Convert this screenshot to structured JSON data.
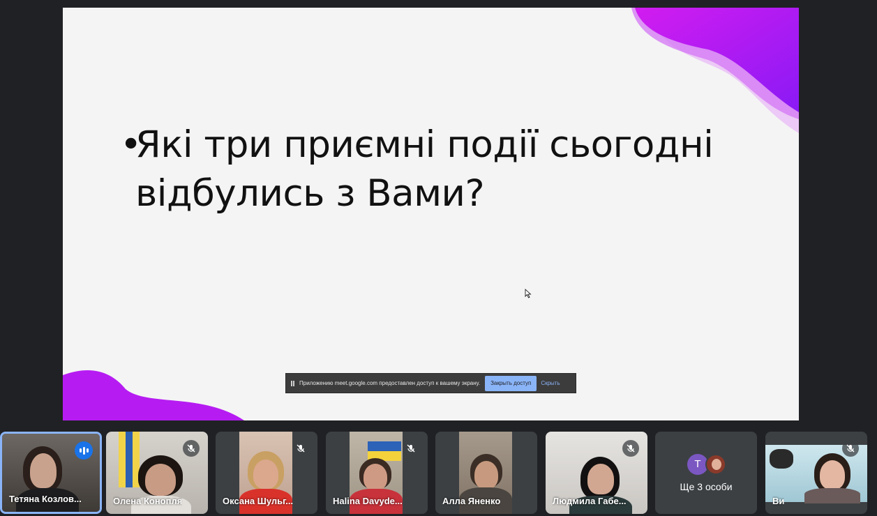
{
  "slide": {
    "bullet": "•",
    "line1": "Які три приємні події сьогодні",
    "line2": "відбулись з Вами?"
  },
  "share_bar": {
    "message": "Приложению meet.google.com предоставлен доступ к вашему экрану.",
    "stop_label": "Закрыть доступ",
    "hide_label": "Скрыть"
  },
  "participants": [
    {
      "name": "Тетяна Козлов...",
      "speaking": true
    },
    {
      "name": "Олена Конопля",
      "muted": true
    },
    {
      "name": "Оксана Шульг...",
      "muted": true
    },
    {
      "name": "Halina Davyde...",
      "muted": true
    },
    {
      "name": "Алла Яненко",
      "muted": false
    },
    {
      "name": "Людмила Габе...",
      "muted": true
    },
    {
      "more_label": "Ще 3 особи",
      "avatar_letter": "Т"
    },
    {
      "name": "Ви",
      "muted": true
    }
  ],
  "colors": {
    "accent_purple": "#b41af0",
    "active_blue": "#8ab4f8"
  }
}
